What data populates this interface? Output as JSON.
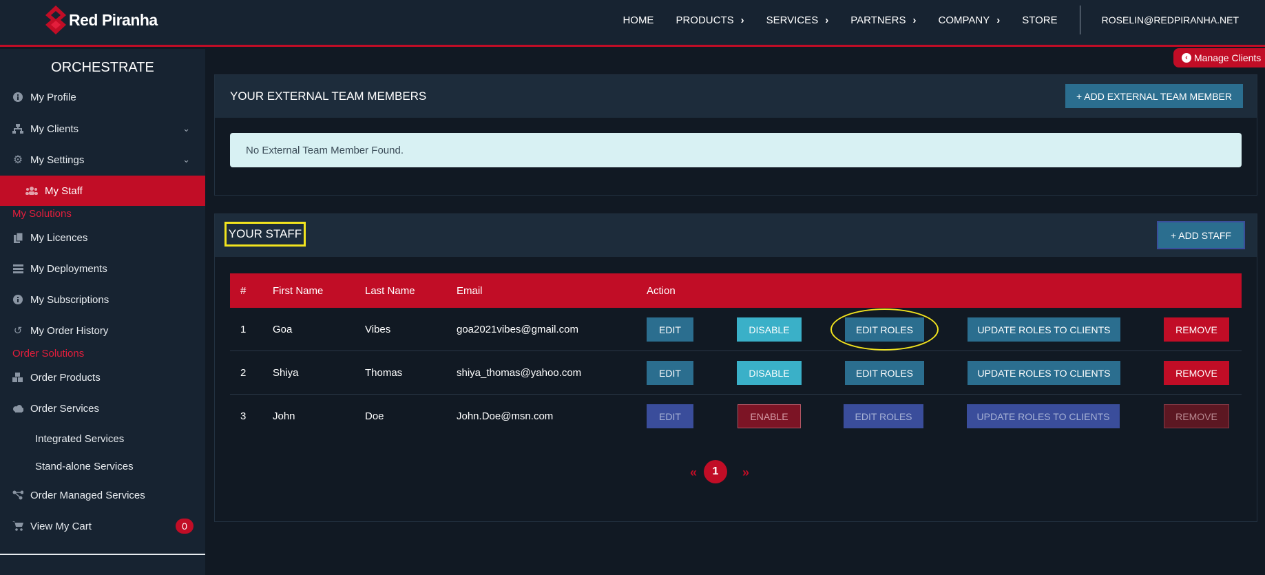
{
  "brand": {
    "name": "Red Piranha"
  },
  "nav": {
    "home": "HOME",
    "products": "PRODUCTS",
    "services": "SERVICES",
    "partners": "PARTNERS",
    "company": "COMPANY",
    "store": "STORE",
    "user": "ROSELIN@REDPIRANHA.NET"
  },
  "sidebar": {
    "title": "ORCHESTRATE",
    "my_profile": "My Profile",
    "my_clients": "My Clients",
    "my_settings": "My Settings",
    "my_staff": "My Staff",
    "my_solutions": "My Solutions",
    "my_licences": "My Licences",
    "my_deployments": "My Deployments",
    "my_subscriptions": "My Subscriptions",
    "my_order_history": "My Order History",
    "order_solutions": "Order Solutions",
    "order_products": "Order Products",
    "order_services": "Order Services",
    "integrated_services": "Integrated Services",
    "standalone_services": "Stand-alone Services",
    "order_managed_services": "Order Managed Services",
    "view_my_cart": "View My Cart",
    "cart_count": "0"
  },
  "manage_clients": "Manage Clients",
  "external": {
    "title": "YOUR EXTERNAL TEAM MEMBERS",
    "add_button": "+ ADD EXTERNAL TEAM MEMBER",
    "empty_message": "No External Team Member Found."
  },
  "staff": {
    "title": "YOUR STAFF",
    "add_button": "+ ADD STAFF",
    "columns": {
      "num": "#",
      "first": "First Name",
      "last": "Last Name",
      "email": "Email",
      "action": "Action"
    },
    "actions": {
      "edit": "EDIT",
      "disable": "DISABLE",
      "enable": "ENABLE",
      "edit_roles": "EDIT ROLES",
      "update_roles": "UPDATE ROLES TO CLIENTS",
      "remove": "REMOVE"
    },
    "rows": [
      {
        "num": "1",
        "first": "Goa",
        "last": "Vibes",
        "email": "goa2021vibes@gmail.com",
        "status": "active"
      },
      {
        "num": "2",
        "first": "Shiya",
        "last": "Thomas",
        "email": "shiya_thomas@yahoo.com",
        "status": "active"
      },
      {
        "num": "3",
        "first": "John",
        "last": "Doe",
        "email": "John.Doe@msn.com",
        "status": "disabled"
      }
    ]
  },
  "pagination": {
    "prev": "«",
    "current": "1",
    "next": "»"
  }
}
